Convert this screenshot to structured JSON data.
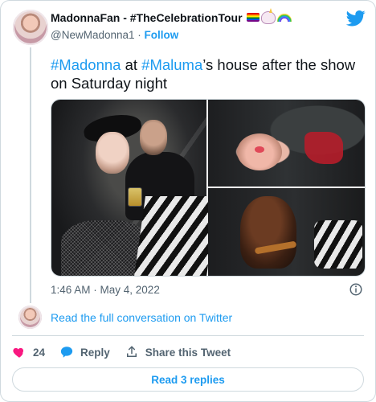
{
  "tweet": {
    "user": {
      "display_name": "MadonnaFan - #TheCelebrationTour",
      "handle": "@NewMadonna1",
      "separator": "·",
      "follow_label": "Follow",
      "emoji_icons": [
        "rainbow-flag-icon",
        "unicorn-icon",
        "rainbow-icon"
      ]
    },
    "text": {
      "hashtag1": "#Madonna",
      "t1": " at ",
      "hashtag2": "#Maluma",
      "t2": "’s house after the show on Saturday night"
    },
    "timestamp": "1:46 AM · May 4, 2022",
    "conversation_link": "Read the full conversation on Twitter",
    "actions": {
      "like_count": "24",
      "reply_label": "Reply",
      "share_label": "Share this Tweet"
    },
    "read_replies_label": "Read 3 replies"
  },
  "colors": {
    "accent": "#1d9bf0",
    "text": "#0f1419",
    "secondary_text": "#536471",
    "like": "#f91880",
    "border": "#cfd9de"
  }
}
